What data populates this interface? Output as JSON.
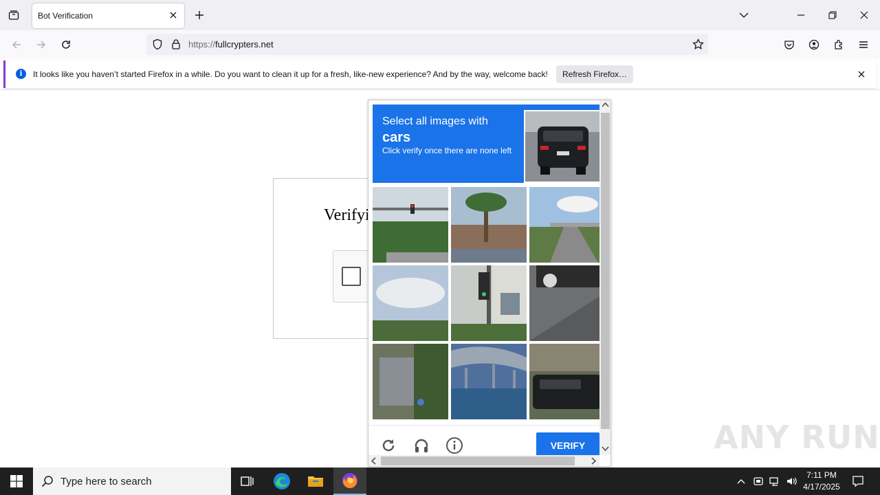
{
  "browser": {
    "tab_title": "Bot Verification",
    "url_scheme": "https://",
    "url_host": "fullcrypters.net"
  },
  "notification": {
    "message": "It looks like you haven’t started Firefox in a while. Do you want to clean it up for a fresh, like-new experience? And by the way, welcome back!",
    "button": "Refresh Firefox…"
  },
  "page": {
    "heading": "Verifyi"
  },
  "challenge": {
    "line1": "Select all images with",
    "target": "cars",
    "line3": "Click verify once there are none left",
    "verify_label": "VERIFY",
    "tiles": [
      "traffic-light-trees",
      "palm-tree-building",
      "highway-overpass",
      "clouds-trees",
      "traffic-light-building",
      "car-parking",
      "storefront-trees",
      "bridge-water",
      "suv-trees"
    ]
  },
  "watermark": "ANY RUN",
  "taskbar": {
    "search_placeholder": "Type here to search",
    "time": "7:11 PM",
    "date": "4/17/2025"
  },
  "colors": {
    "accent": "#1a73e8",
    "notification_border": "#8c37d6",
    "taskbar": "#1f1f1f"
  }
}
